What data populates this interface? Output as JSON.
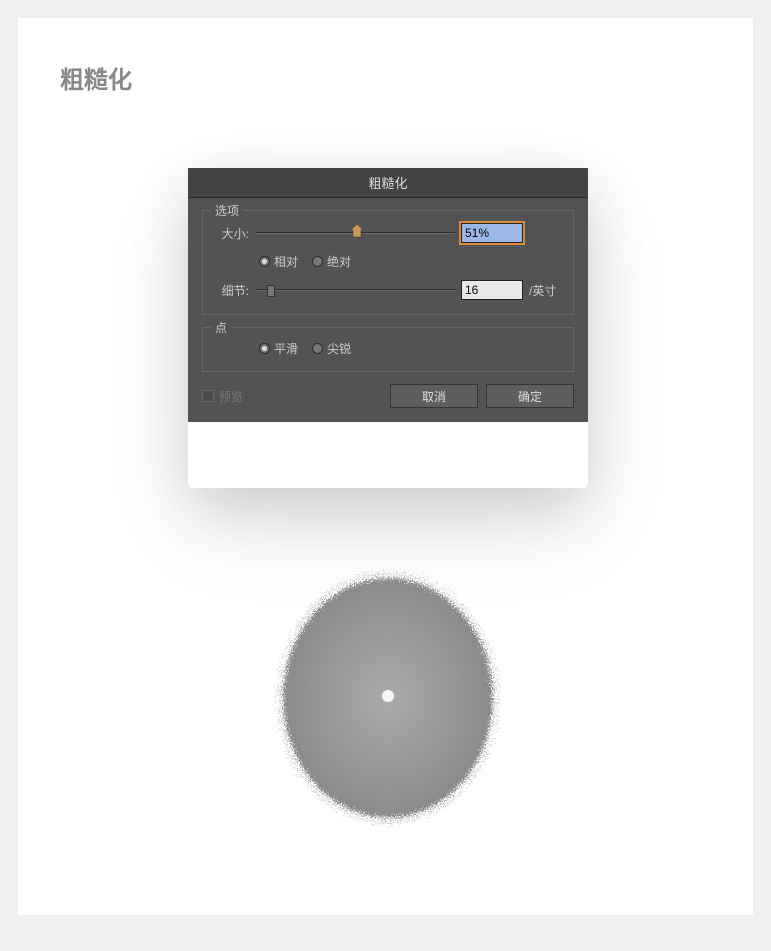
{
  "page": {
    "title": "粗糙化"
  },
  "dialog": {
    "title": "粗糙化",
    "options": {
      "legend": "选项",
      "size": {
        "label": "大小:",
        "value": "51%",
        "sliderPercent": 51,
        "modes": {
          "relative": "相对",
          "absolute": "绝对",
          "selected": "relative"
        }
      },
      "detail": {
        "label": "细节:",
        "value": "16",
        "unit": "/英寸",
        "sliderPercent": 8
      }
    },
    "points": {
      "legend": "点",
      "smooth": "平滑",
      "sharp": "尖锐",
      "selected": "smooth"
    },
    "preview": {
      "label": "预览"
    },
    "buttons": {
      "cancel": "取消",
      "ok": "确定"
    }
  }
}
